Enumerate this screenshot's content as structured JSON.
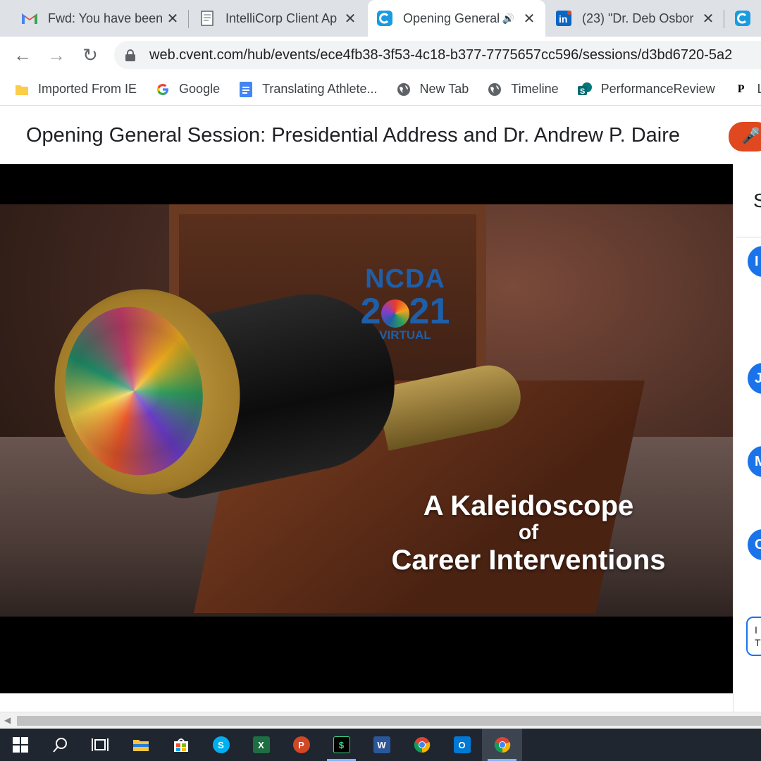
{
  "browser": {
    "tabs": [
      {
        "title": "Fwd: You have been",
        "icon": "gmail-icon",
        "active": false
      },
      {
        "title": "IntelliCorp Client Ap",
        "icon": "document-icon",
        "active": false
      },
      {
        "title": "Opening General",
        "icon": "cvent-icon",
        "active": true,
        "audio": true
      },
      {
        "title": "(23) \"Dr. Deb Osbor",
        "icon": "linkedin-icon",
        "active": false
      },
      {
        "title": "",
        "icon": "cvent-icon",
        "active": false
      }
    ],
    "url": "web.cvent.com/hub/events/ece4fb38-3f53-4c18-b377-7775657cc596/sessions/d3bd6720-5a2",
    "bookmarks": [
      {
        "label": "Imported From IE",
        "icon": "folder-icon"
      },
      {
        "label": "Google",
        "icon": "google-icon"
      },
      {
        "label": "Translating Athlete...",
        "icon": "docs-icon"
      },
      {
        "label": "New Tab",
        "icon": "globe-icon"
      },
      {
        "label": "Timeline",
        "icon": "globe-icon"
      },
      {
        "label": "PerformanceReview",
        "icon": "sharepoint-icon"
      },
      {
        "label": "Le",
        "icon": "p-icon"
      }
    ]
  },
  "page": {
    "title": "Opening General Session: Presidential Address and Dr. Andrew P. Daire"
  },
  "video": {
    "logo_line1": "NCDA",
    "logo_year_left": "2",
    "logo_year_right": "21",
    "logo_line3": "VIRTUAL",
    "overlay_line1": "A Kaleidoscope",
    "overlay_line2": "of",
    "overlay_line3": "Career Interventions"
  },
  "side_panel": {
    "title_initial": "S",
    "avatars": [
      "I",
      "J",
      "M",
      "C"
    ],
    "chat_preview": [
      "I",
      "T"
    ]
  },
  "taskbar": {
    "apps": [
      "windows-start-icon",
      "search-icon",
      "task-view-icon",
      "file-explorer-icon",
      "store-icon",
      "skype-icon",
      "excel-icon",
      "powerpoint-icon",
      "app-s-icon",
      "word-icon",
      "chrome-icon",
      "outlook-icon",
      "chrome-active-icon"
    ]
  },
  "colors": {
    "accent": "#1a73e8",
    "record_button": "#e0481f",
    "taskbar": "#1f2630",
    "ncda_blue": "#1f5fa8"
  }
}
